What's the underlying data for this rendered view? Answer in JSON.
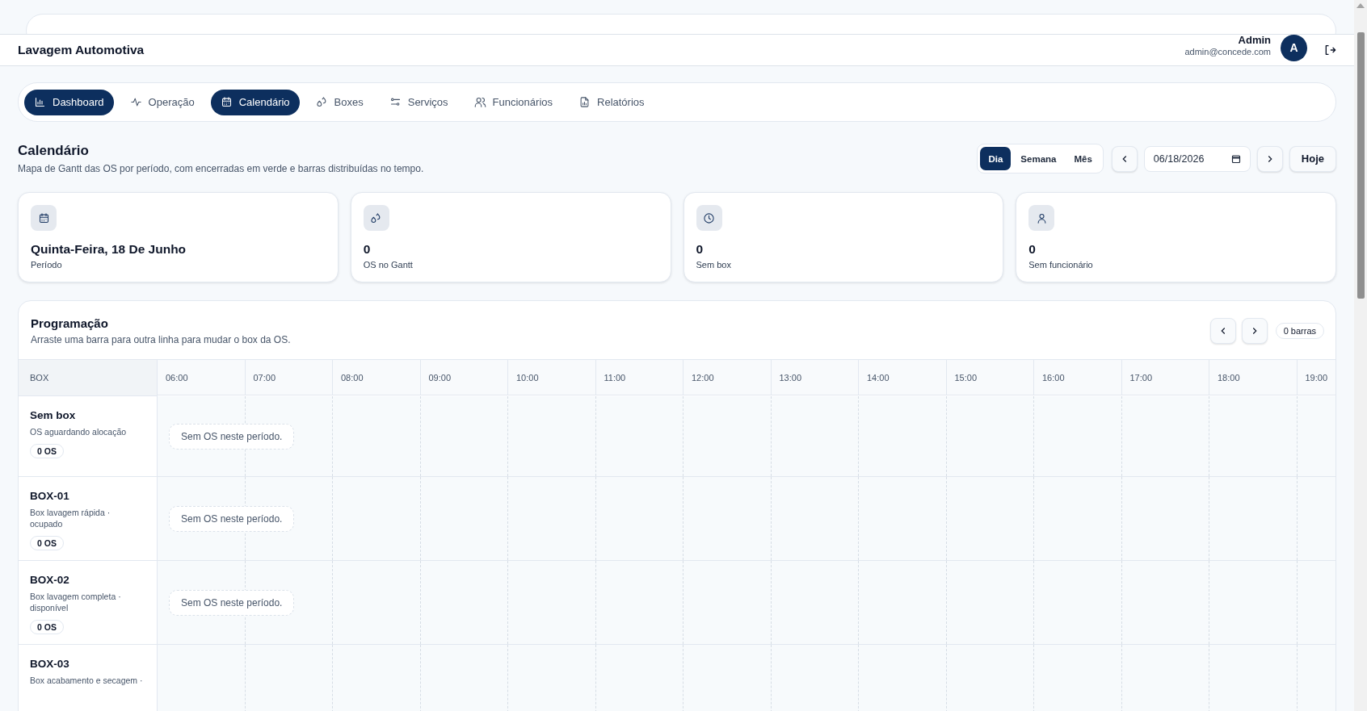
{
  "header": {
    "title": "Lavagem Automotiva",
    "user_name": "Admin",
    "user_email": "admin@concede.com",
    "avatar_initial": "A"
  },
  "nav": [
    {
      "label": "Dashboard",
      "kind": "chart",
      "selected": true
    },
    {
      "label": "Operação",
      "kind": "pulse",
      "selected": false
    },
    {
      "label": "Calendário",
      "kind": "calendar",
      "selected": true
    },
    {
      "label": "Boxes",
      "kind": "drops",
      "selected": false
    },
    {
      "label": "Serviços",
      "kind": "sliders",
      "selected": false
    },
    {
      "label": "Funcionários",
      "kind": "users",
      "selected": false
    },
    {
      "label": "Relatórios",
      "kind": "report",
      "selected": false
    }
  ],
  "page": {
    "title": "Calendário",
    "subtitle": "Mapa de Gantt das OS por período, com encerradas em verde e barras distribuídas no tempo."
  },
  "view_modes": [
    {
      "label": "Dia",
      "selected": true
    },
    {
      "label": "Semana",
      "selected": false
    },
    {
      "label": "Mês",
      "selected": false
    }
  ],
  "date_value": "06/18/2026",
  "today_button": "Hoje",
  "stats": [
    {
      "kind": "calendar",
      "value": "Quinta-Feira, 18 De Junho",
      "label": "Período"
    },
    {
      "kind": "drops",
      "value": "0",
      "label": "OS no Gantt"
    },
    {
      "kind": "clock",
      "value": "0",
      "label": "Sem box"
    },
    {
      "kind": "user",
      "value": "0",
      "label": "Sem funcionário"
    }
  ],
  "schedule": {
    "title": "Programação",
    "subtitle": "Arraste uma barra para outra linha para mudar o box da OS.",
    "bar_count": "0 barras",
    "box_column": "BOX",
    "hours": [
      "06:00",
      "07:00",
      "08:00",
      "09:00",
      "10:00",
      "11:00",
      "12:00",
      "13:00",
      "14:00",
      "15:00",
      "16:00",
      "17:00",
      "18:00",
      "19:00"
    ],
    "rows": [
      {
        "name": "Sem box",
        "description": "OS aguardando alocação",
        "count": "0 OS",
        "empty_message": "Sem OS neste período."
      },
      {
        "name": "BOX-01",
        "description": "Box lavagem rápida · ocupado",
        "count": "0 OS",
        "empty_message": "Sem OS neste período."
      },
      {
        "name": "BOX-02",
        "description": "Box lavagem completa · disponível",
        "count": "0 OS",
        "empty_message": "Sem OS neste período."
      },
      {
        "name": "BOX-03",
        "description": "Box acabamento e secagem ·"
      }
    ]
  }
}
